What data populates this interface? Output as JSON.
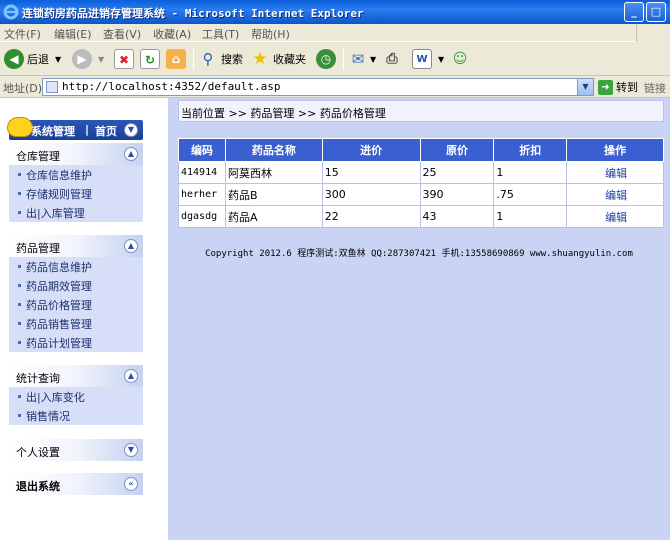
{
  "window": {
    "title": "连锁药房药品进销存管理系统 - Microsoft Internet Explorer",
    "minimize": "_",
    "maximize": "□"
  },
  "menubar": {
    "items": [
      "文件(F)",
      "编辑(E)",
      "查看(V)",
      "收藏(A)",
      "工具(T)",
      "帮助(H)"
    ]
  },
  "toolbar": {
    "back": "后退",
    "search": "搜索",
    "favorites": "收藏夹"
  },
  "addressbar": {
    "label": "地址(D)",
    "url": "http://localhost:4352/default.asp",
    "go": "转到",
    "links": "链接"
  },
  "sidebar": {
    "header_title": "系统管理",
    "header_sep": "|",
    "header_home": "首页",
    "groups": [
      {
        "title": "仓库管理",
        "items": [
          "仓库信息维护",
          "存储规则管理",
          "出|入库管理"
        ]
      },
      {
        "title": "药品管理",
        "items": [
          "药品信息维护",
          "药品期效管理",
          "药品价格管理",
          "药品销售管理",
          "药品计划管理"
        ]
      },
      {
        "title": "统计查询",
        "items": [
          "出|入库变化",
          "销售情况"
        ]
      },
      {
        "title": "个人设置",
        "items": []
      },
      {
        "title": "退出系统",
        "items": []
      }
    ]
  },
  "breadcrumb": "当前位置 >> 药品管理 >> 药品价格管理",
  "table": {
    "headers": [
      "编码",
      "药品名称",
      "进价",
      "原价",
      "折扣",
      "操作"
    ],
    "rows": [
      [
        "414914",
        "阿莫西林",
        "15",
        "25",
        "1",
        "编辑"
      ],
      [
        "herher",
        "药品B",
        "300",
        "390",
        ".75",
        "编辑"
      ],
      [
        "dgasdg",
        "药品A",
        "22",
        "43",
        "1",
        "编辑"
      ]
    ]
  },
  "footer": {
    "copyright": "Copyright 2012.6 程序测试:双鱼林 QQ:287307421 手机:13558690869 www.shuangyulin.com"
  }
}
